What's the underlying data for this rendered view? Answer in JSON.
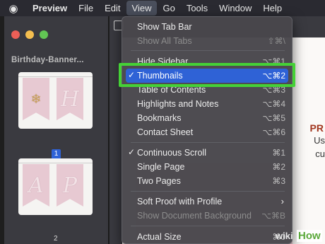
{
  "menubar": {
    "apple": "",
    "app_name": "Preview",
    "items": [
      "File",
      "Edit",
      "View",
      "Go",
      "Tools",
      "Window",
      "Help"
    ]
  },
  "sidebar": {
    "doc_title": "Birthday-Banner...",
    "pages": [
      {
        "number": "1",
        "letters": "H",
        "selected": true
      },
      {
        "number": "2",
        "letters": "AP",
        "selected": false
      }
    ]
  },
  "document": {
    "line1": "PR",
    "line2": "Us",
    "line3": "cu"
  },
  "view_menu": {
    "items": [
      {
        "label": "Show Tab Bar",
        "shortcut": "",
        "checked": false,
        "disabled": false
      },
      {
        "label": "Show All Tabs",
        "shortcut": "⇧⌘\\",
        "checked": false,
        "disabled": true
      },
      {
        "label": "Hide Sidebar",
        "shortcut": "⌥⌘1",
        "checked": false,
        "disabled": false
      },
      {
        "label": "Thumbnails",
        "shortcut": "⌥⌘2",
        "checked": true,
        "disabled": false,
        "highlighted": true
      },
      {
        "label": "Table of Contents",
        "shortcut": "⌥⌘3",
        "checked": false,
        "disabled": false
      },
      {
        "label": "Highlights and Notes",
        "shortcut": "⌥⌘4",
        "checked": false,
        "disabled": false
      },
      {
        "label": "Bookmarks",
        "shortcut": "⌥⌘5",
        "checked": false,
        "disabled": false
      },
      {
        "label": "Contact Sheet",
        "shortcut": "⌥⌘6",
        "checked": false,
        "disabled": false
      },
      {
        "label": "Continuous Scroll",
        "shortcut": "⌘1",
        "checked": true,
        "disabled": false
      },
      {
        "label": "Single Page",
        "shortcut": "⌘2",
        "checked": false,
        "disabled": false
      },
      {
        "label": "Two Pages",
        "shortcut": "⌘3",
        "checked": false,
        "disabled": false
      },
      {
        "label": "Soft Proof with Profile",
        "shortcut": "",
        "checked": false,
        "disabled": false,
        "submenu": true
      },
      {
        "label": "Show Document Background",
        "shortcut": "⌥⌘B",
        "checked": false,
        "disabled": true
      },
      {
        "label": "Actual Size",
        "shortcut": "⌘0",
        "checked": false,
        "disabled": false
      }
    ],
    "check_glyph": "✓",
    "submenu_glyph": "›"
  },
  "watermark": {
    "part1": "wiki",
    "part2": "How"
  },
  "colors": {
    "highlight": "#2f62d6",
    "callout": "#45d136"
  }
}
